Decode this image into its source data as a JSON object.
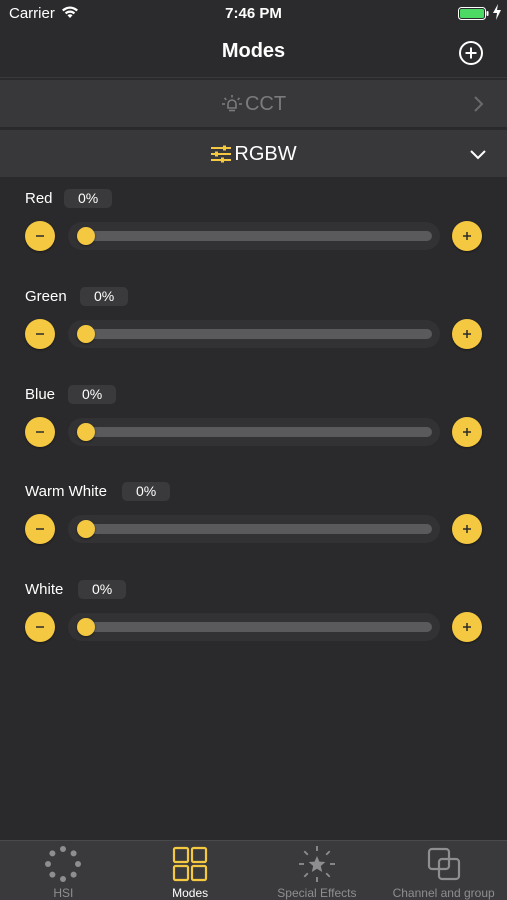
{
  "status": {
    "carrier": "Carrier",
    "time": "7:46 PM"
  },
  "nav": {
    "title": "Modes"
  },
  "modes": [
    {
      "label": "CCT",
      "icon": "bulb-icon",
      "expanded": false
    },
    {
      "label": "RGBW",
      "icon": "sliders-icon",
      "expanded": true
    }
  ],
  "channels": [
    {
      "label": "Red",
      "value": "0%",
      "level": 0
    },
    {
      "label": "Green",
      "value": "0%",
      "level": 0
    },
    {
      "label": "Blue",
      "value": "0%",
      "level": 0
    },
    {
      "label": "Warm White",
      "value": "0%",
      "level": 0
    },
    {
      "label": "White",
      "value": "0%",
      "level": 0
    }
  ],
  "tabs": [
    {
      "label": "HSI",
      "icon": "hsi-dots-icon",
      "active": false
    },
    {
      "label": "Modes",
      "icon": "grid-icon",
      "active": true
    },
    {
      "label": "Special Effects",
      "icon": "star-burst-icon",
      "active": false
    },
    {
      "label": "Channel and group",
      "icon": "overlap-squares-icon",
      "active": false
    }
  ],
  "colors": {
    "accent": "#f5c842",
    "background": "#2a2a2c",
    "row": "#38383a",
    "muted": "#7b7b7e"
  }
}
